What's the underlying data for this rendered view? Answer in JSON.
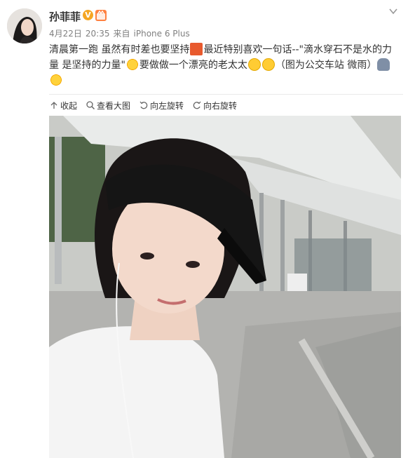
{
  "user": {
    "name": "孙菲菲"
  },
  "meta": {
    "date": "4月22日",
    "time": "20:35",
    "source_prefix": "来自",
    "source": "iPhone 6 Plus"
  },
  "content": {
    "part1": "清晨第一跑 虽然有时差也要坚持",
    "part2": "最近特别喜欢一句话--\"滴水穿石不是水的力量 是坚持的力量\"",
    "part3": "要做做一个漂亮的老太太",
    "part4": "（图为公交车站 微雨）"
  },
  "toolbar": {
    "collapse": "收起",
    "view_large": "查看大图",
    "rotate_left": "向左旋转",
    "rotate_right": "向右旋转"
  },
  "icons": {
    "verified": "verified-v-badge-icon",
    "vip": "vip-badge-icon",
    "menu": "chevron-down-icon"
  },
  "colors": {
    "verified": "#f5a623",
    "vip": "#ff8140",
    "meta_text": "#808080"
  }
}
